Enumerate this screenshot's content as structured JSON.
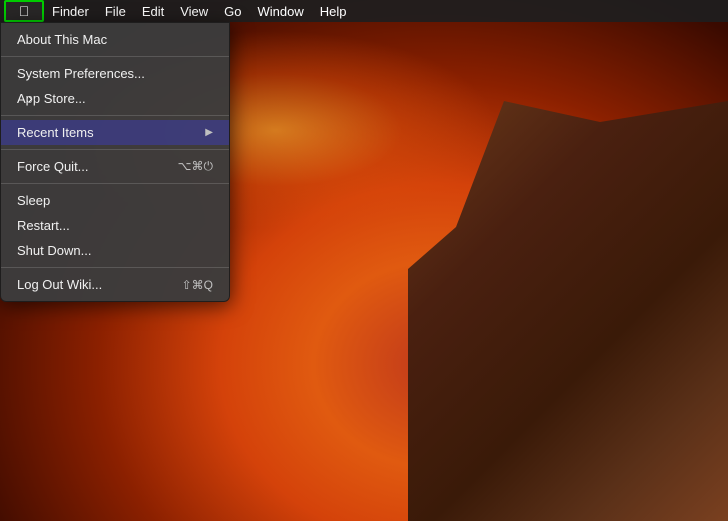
{
  "menubar": {
    "apple_icon": "⌘",
    "items": [
      {
        "label": "Finder"
      },
      {
        "label": "File"
      },
      {
        "label": "Edit"
      },
      {
        "label": "View"
      },
      {
        "label": "Go"
      },
      {
        "label": "Window"
      },
      {
        "label": "Help"
      }
    ]
  },
  "apple_menu": {
    "items": [
      {
        "id": "about",
        "label": "About This Mac",
        "shortcut": "",
        "has_arrow": false,
        "divider_after": false
      },
      {
        "id": "divider1",
        "is_divider": true
      },
      {
        "id": "system-prefs",
        "label": "System Preferences...",
        "shortcut": "",
        "has_arrow": false,
        "divider_after": false
      },
      {
        "id": "app-store",
        "label": "App Store...",
        "shortcut": "",
        "has_arrow": false,
        "divider_after": false
      },
      {
        "id": "divider2",
        "is_divider": true
      },
      {
        "id": "recent-items",
        "label": "Recent Items",
        "shortcut": "",
        "has_arrow": true,
        "divider_after": false
      },
      {
        "id": "divider3",
        "is_divider": true
      },
      {
        "id": "force-quit",
        "label": "Force Quit...",
        "shortcut": "⌥⌘⏻",
        "has_arrow": false,
        "divider_after": false
      },
      {
        "id": "divider4",
        "is_divider": true
      },
      {
        "id": "sleep",
        "label": "Sleep",
        "shortcut": "",
        "has_arrow": false,
        "divider_after": false
      },
      {
        "id": "restart",
        "label": "Restart...",
        "shortcut": "",
        "has_arrow": false,
        "divider_after": false
      },
      {
        "id": "shutdown",
        "label": "Shut Down...",
        "shortcut": "",
        "has_arrow": false,
        "divider_after": false
      },
      {
        "id": "divider5",
        "is_divider": true
      },
      {
        "id": "logout",
        "label": "Log Out Wiki...",
        "shortcut": "⇧⌘Q",
        "has_arrow": false,
        "divider_after": false
      }
    ]
  },
  "icons": {
    "apple": "🍎",
    "arrow_right": "▶"
  }
}
